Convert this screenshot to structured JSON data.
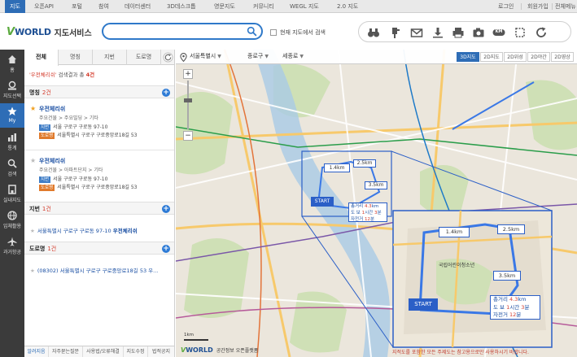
{
  "topnav": {
    "items": [
      "지도",
      "오픈API",
      "포털",
      "참여",
      "데이터센터",
      "3D데스크톱",
      "영문지도",
      "커뮤니티",
      "WEGL 지도",
      "2.0 지도"
    ],
    "right": [
      "로그인",
      "회원가입",
      "전체메뉴"
    ]
  },
  "header": {
    "logo_v": "V",
    "logo_world": "WORLD",
    "logo_service": "지도서비스",
    "search_value": "",
    "checkbox_label": "현재 지도에서 검색"
  },
  "toolbar": {
    "icons": [
      "binoculars-icon",
      "thumbtack-icon",
      "mail-icon",
      "download-icon",
      "print-icon",
      "camera-icon",
      "km-icon",
      "crop-icon",
      "refresh-icon"
    ],
    "km_label": "KM"
  },
  "iconbar": [
    {
      "label": "홈",
      "icon": "home-icon"
    },
    {
      "label": "지도선택",
      "icon": "map-select-icon"
    },
    {
      "label": "My",
      "icon": "star-icon"
    },
    {
      "label": "통계",
      "icon": "stats-icon"
    },
    {
      "label": "검색",
      "icon": "search-icon"
    },
    {
      "label": "실내지도",
      "icon": "indoor-map-icon"
    },
    {
      "label": "입체활용",
      "icon": "globe-icon"
    },
    {
      "label": "과거항공",
      "icon": "airplane-icon"
    }
  ],
  "panel": {
    "tabs": [
      "전체",
      "명칭",
      "지번",
      "도로명"
    ],
    "summary_query": "'우전체리쉬'",
    "summary_text": "검색결과 총",
    "summary_count": "4건",
    "sections": [
      {
        "title": "명칭",
        "count": "2건"
      },
      {
        "title": "지번",
        "count": "1건"
      },
      {
        "title": "도로명",
        "count": "1건"
      }
    ],
    "entries": [
      {
        "name": "우전체리쉬",
        "category": "주요건물 > 주요빌딩 > 기타",
        "jibun_badge": "지번",
        "jibun": "서울 구로구 구로동 97-10",
        "road_badge": "도로명",
        "road": "서울특별시 구로구 구로중앙로18길 53"
      },
      {
        "name": "우전체리쉬",
        "category": "주요건물 > 아파트단지 > 기타",
        "jibun_badge": "지번",
        "jibun": "서울 구로구 구로동 97-10",
        "road_badge": "도로명",
        "road": "서울특별시 구로구 구로중앙로18길 53"
      }
    ],
    "jibun_item_prefix": "서울특별시 구로구 구로동 97-10",
    "jibun_item_highlight": "우전체리쉬",
    "road_item": "(08302) 서울특별시 구로구 구로중앙로18길 53 우...",
    "footer": [
      "알려지음",
      "자주묻는질문",
      "사용법/오류해결",
      "지도수정",
      "법적공지"
    ]
  },
  "map": {
    "location": [
      "서울특별시",
      "종로구",
      "세종로"
    ],
    "types": [
      "3D지도",
      "2D지도",
      "2D위성",
      "2D야간",
      "2D영상"
    ],
    "active_type": "3D지도",
    "start_label": "START",
    "segments": [
      "1.4km",
      "2.5km",
      "3.5km"
    ],
    "info_dist_label": "총거리",
    "info_dist": "4.3",
    "info_dist_unit": "km",
    "info_walk_label": "도 보",
    "info_walk_h": "1",
    "info_walk_h_unit": "시간",
    "info_walk_m": "3",
    "info_walk_m_unit": "분",
    "info_bike_label": "자전거",
    "info_bike_m": "12",
    "info_bike_unit": "분",
    "place_label": "국립어린이청소년",
    "zoom_in": "+",
    "zoom_out": "−",
    "bottom_logo_v": "V",
    "bottom_logo_world": "WORLD",
    "bottom_logo_extra": "공간정보 오픈플랫폼",
    "scale_label": "1km",
    "disclaimer": "지적도를 포함한 모든 주제도는 참고용으로만 사용하시기 바랍니다."
  }
}
